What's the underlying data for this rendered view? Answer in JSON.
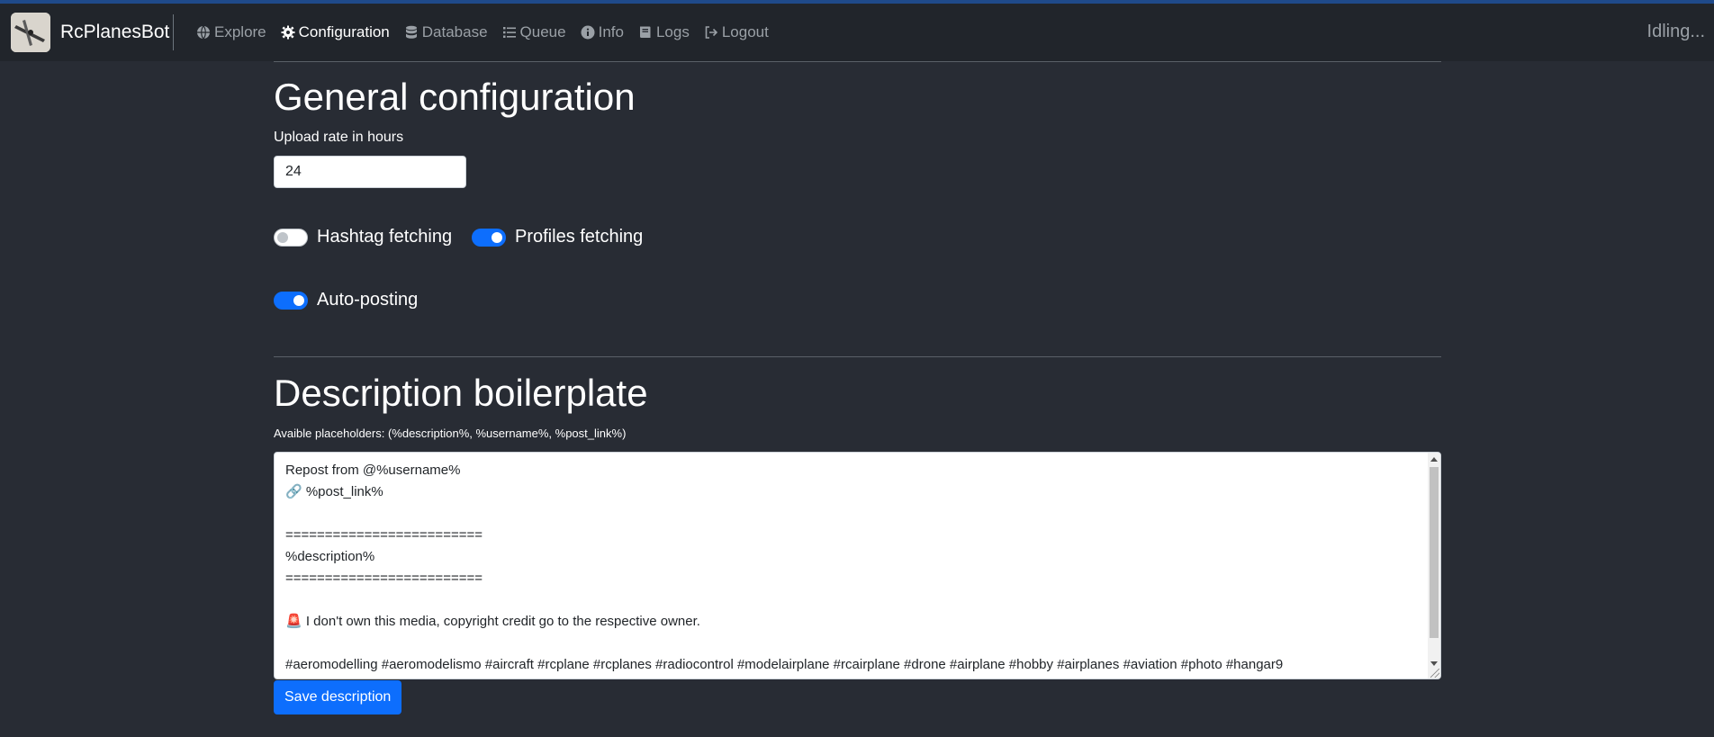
{
  "app": {
    "name": "RcPlanesBot",
    "status": "Idling..."
  },
  "nav": {
    "items": [
      {
        "label": "Explore",
        "icon": "globe-icon",
        "active": false
      },
      {
        "label": "Configuration",
        "icon": "gear-icon",
        "active": true
      },
      {
        "label": "Database",
        "icon": "database-icon",
        "active": false
      },
      {
        "label": "Queue",
        "icon": "list-icon",
        "active": false
      },
      {
        "label": "Info",
        "icon": "info-icon",
        "active": false
      },
      {
        "label": "Logs",
        "icon": "book-icon",
        "active": false
      },
      {
        "label": "Logout",
        "icon": "logout-icon",
        "active": false
      }
    ]
  },
  "general": {
    "title": "General configuration",
    "upload_rate_label": "Upload rate in hours",
    "upload_rate_value": "24",
    "toggles": {
      "hashtag": {
        "label": "Hashtag fetching",
        "on": false
      },
      "profiles": {
        "label": "Profiles fetching",
        "on": true
      },
      "autopost": {
        "label": "Auto-posting",
        "on": true
      }
    }
  },
  "description": {
    "title": "Description boilerplate",
    "placeholders_hint": "Avaible placeholders: (%description%, %username%, %post_link%)",
    "text": "Repost from @%username%\n🔗 %post_link%\n\n=========================\n%description%\n=========================\n\n🚨 I don't own this media, copyright credit go to the respective owner.\n\n#aeromodelling #aeromodelismo #aircraft #rcplane #rcplanes #radiocontrol #modelairplane #rcairplane #drone #airplane #hobby #airplanes #aviation #photo #hangar9",
    "save_label": "Save description"
  },
  "colors": {
    "accent": "#0d6efd",
    "background": "#282c34",
    "navbar": "#21252b"
  }
}
